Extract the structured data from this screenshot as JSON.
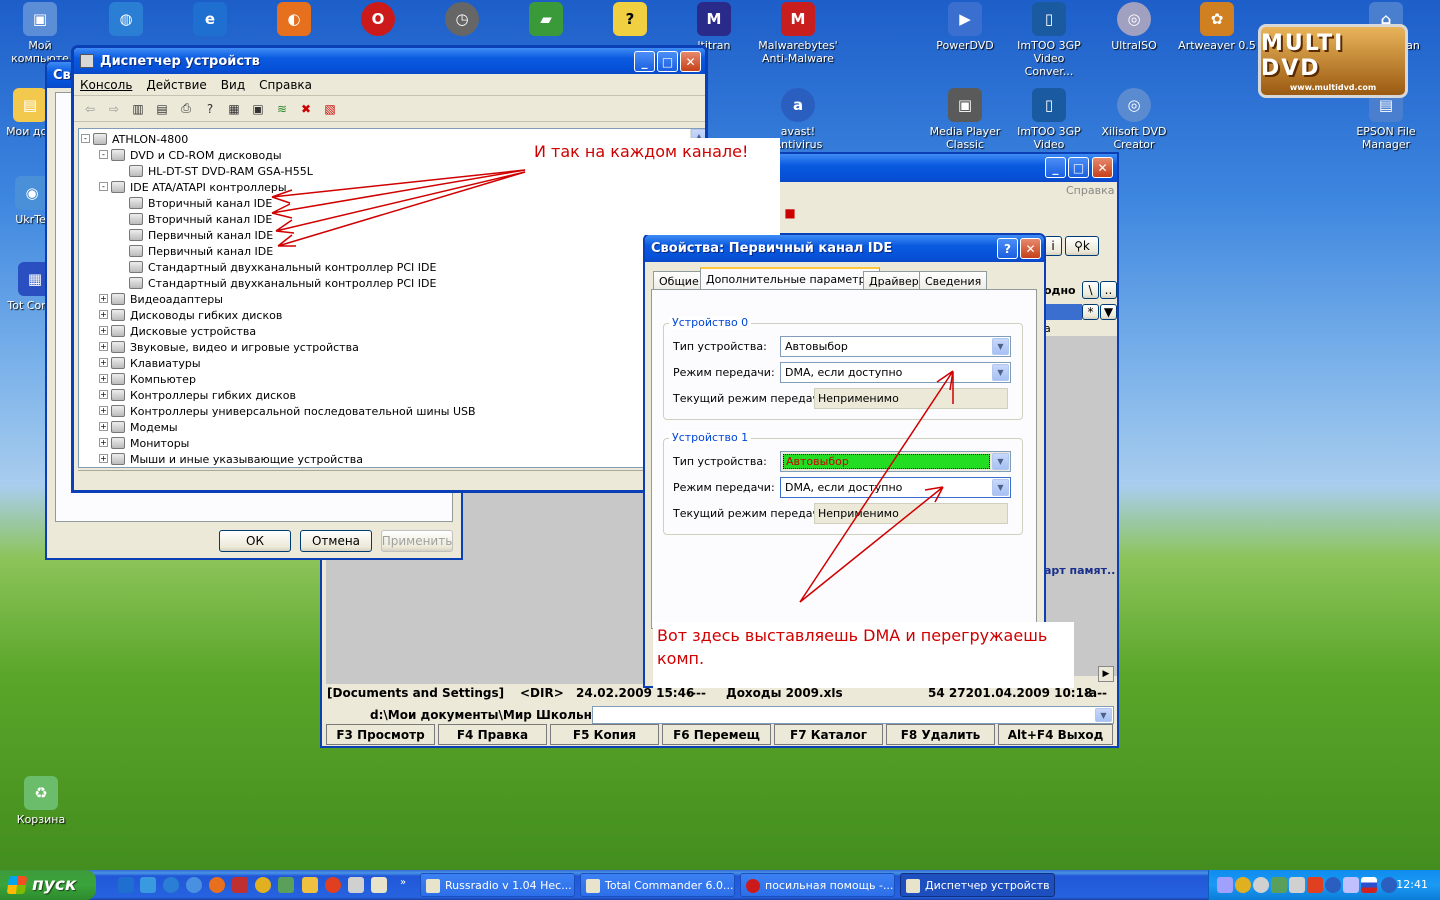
{
  "desktop": {
    "left_icons": [
      {
        "label": "Мой компьюте",
        "color": "#5b8ed6"
      },
      {
        "label": "Мои док",
        "color": "#f2c94c"
      },
      {
        "label": "UkrTel",
        "color": "#4a90d9"
      },
      {
        "label": "Tot Comm",
        "color": "#2a4fc0"
      },
      {
        "label": "Корзина",
        "color": "#6bbd6b"
      }
    ],
    "top_icons": [
      {
        "label": "",
        "color": "#2a7fd4"
      },
      {
        "label": "",
        "color": "#1e6fd0"
      },
      {
        "label": "",
        "color": "#e6701e"
      },
      {
        "label": "",
        "color": "#cc1a1a"
      },
      {
        "label": "",
        "color": "#666666"
      },
      {
        "label": "",
        "color": "#3a9a3a"
      },
      {
        "label": "",
        "color": "#f0d040"
      },
      {
        "label": "ltitran",
        "color": "#2a2a8a"
      },
      {
        "label": "Malwarebytes' Anti-Malware",
        "color": "#c81e1e"
      },
      {
        "label": "avast! Antivirus",
        "color": "#2a5fc0"
      },
      {
        "label": "PowerDVD",
        "color": "#3a6fd0"
      },
      {
        "label": "ImTOO 3GP Video Conver...",
        "color": "#1a5aa0"
      },
      {
        "label": "UltraISO",
        "color": "#a0a0c0"
      },
      {
        "label": "Artweaver 0.5",
        "color": "#d08020"
      },
      {
        "label": "EPSON Scan",
        "color": "#4a7fd0"
      },
      {
        "label": "Media Player Classic",
        "color": "#5a5a5a"
      },
      {
        "label": "ImTOO 3GP Video Conver...",
        "color": "#1a5aa0"
      },
      {
        "label": "Xilisoft DVD Creator",
        "color": "#5a8ad0"
      },
      {
        "label": "EPSON File Manager",
        "color": "#4a7fd0"
      }
    ],
    "logo_text": "MULTI DVD",
    "logo_url_text": "www.multidvd.com"
  },
  "devmgr": {
    "title": "Диспетчер устройств",
    "menu": [
      "Консоль",
      "Действие",
      "Вид",
      "Справка"
    ],
    "tree": [
      {
        "text": "ATHLON-4800",
        "level": 0,
        "exp": "-"
      },
      {
        "text": "DVD и CD-ROM дисководы",
        "level": 1,
        "exp": "-"
      },
      {
        "text": "HL-DT-ST DVD-RAM GSA-H55L",
        "level": 2,
        "exp": ""
      },
      {
        "text": "IDE ATA/ATAPI контроллеры",
        "level": 1,
        "exp": "-"
      },
      {
        "text": "Вторичный канал IDE",
        "level": 2,
        "exp": ""
      },
      {
        "text": "Вторичный канал IDE",
        "level": 2,
        "exp": ""
      },
      {
        "text": "Первичный канал IDE",
        "level": 2,
        "exp": ""
      },
      {
        "text": "Первичный канал IDE",
        "level": 2,
        "exp": ""
      },
      {
        "text": "Стандартный двухканальный контроллер PCI IDE",
        "level": 2,
        "exp": ""
      },
      {
        "text": "Стандартный двухканальный контроллер PCI IDE",
        "level": 2,
        "exp": ""
      },
      {
        "text": "Видеоадаптеры",
        "level": 1,
        "exp": "+"
      },
      {
        "text": "Дисководы гибких дисков",
        "level": 1,
        "exp": "+"
      },
      {
        "text": "Дисковые устройства",
        "level": 1,
        "exp": "+"
      },
      {
        "text": "Звуковые, видео и игровые устройства",
        "level": 1,
        "exp": "+"
      },
      {
        "text": "Клавиатуры",
        "level": 1,
        "exp": "+"
      },
      {
        "text": "Компьютер",
        "level": 1,
        "exp": "+"
      },
      {
        "text": "Контроллеры гибких дисков",
        "level": 1,
        "exp": "+"
      },
      {
        "text": "Контроллеры универсальной последовательной шины USB",
        "level": 1,
        "exp": "+"
      },
      {
        "text": "Модемы",
        "level": 1,
        "exp": "+"
      },
      {
        "text": "Мониторы",
        "level": 1,
        "exp": "+"
      },
      {
        "text": "Мыши и иные указывающие устройства",
        "level": 1,
        "exp": "+"
      }
    ]
  },
  "sysprops": {
    "title": "Сво",
    "ok": "ОК",
    "cancel": "Отмена",
    "apply": "Применить"
  },
  "totalcmd": {
    "menu_right": "Справка",
    "col_right": "одно",
    "col_name": "а",
    "file_left": "[Documents and Settings]",
    "file_left_type": "<DIR>",
    "file_left_date": "24.02.2009 15:46",
    "file_left_attr": "----",
    "file_right": "Доходы 2009.xls",
    "file_right_size": "54 272",
    "file_right_date": "01.04.2009 10:18",
    "file_right_attr": "-a--",
    "path": "d:\\Мои документы\\Мир Школьника>",
    "truncated_item": "арт памят..",
    "fkeys": [
      "F3 Просмотр",
      "F4 Правка",
      "F5 Копия",
      "F6 Перемещ",
      "F7 Каталог",
      "F8 Удалить",
      "Alt+F4 Выход"
    ]
  },
  "ideprops": {
    "title": "Свойства: Первичный канал IDE",
    "tabs": [
      "Общие",
      "Дополнительные параметры",
      "Драйвер",
      "Сведения"
    ],
    "dev0": {
      "group": "Устройство 0",
      "type_label": "Тип устройства:",
      "type_value": "Автовыбор",
      "mode_label": "Режим передачи:",
      "mode_value": "DMA, если доступно",
      "cur_label": "Текущий режим передачи:",
      "cur_value": "Неприменимо"
    },
    "dev1": {
      "group": "Устройство 1",
      "type_label": "Тип устройства:",
      "type_value": "Автовыбор",
      "type_highlight": "#22dd22",
      "mode_label": "Режим передачи:",
      "mode_value": "DMA, если доступно",
      "cur_label": "Текущий режим передачи:",
      "cur_value": "Неприменимо"
    }
  },
  "annotations": {
    "top": "И так на каждом канале!",
    "bottom": "Вот здесь выставляешь DMA и перегружаешь комп.",
    "color": "#d00000"
  },
  "taskbar": {
    "start": "пуск",
    "tasks": [
      "Russradio v 1.04 Нес...",
      "Total Commander 6.0...",
      "посильная помощь -...",
      "Диспетчер устройств"
    ],
    "clock": "12:41"
  }
}
